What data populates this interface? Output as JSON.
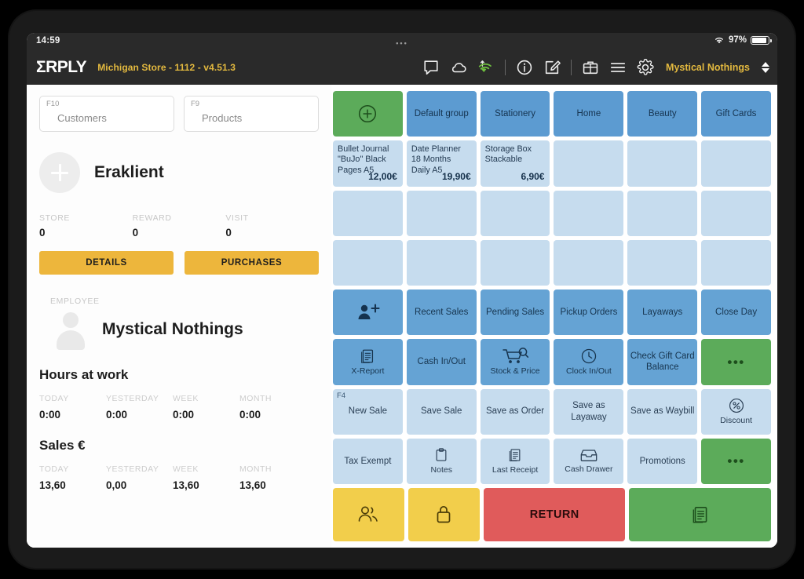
{
  "status_bar": {
    "time": "14:59",
    "dots": "•••",
    "battery_percent": "97%"
  },
  "app_bar": {
    "logo": "ΣRPLY",
    "store": "Michigan Store - 1112 - v4.51.3",
    "user": "Mystical Nothings",
    "icons": [
      "chat-icon",
      "cloud-icon",
      "wifi-sync-icon",
      "info-icon",
      "edit-icon",
      "briefcase-icon",
      "menu-icon",
      "gear-icon"
    ]
  },
  "left_panel": {
    "search": [
      {
        "fkey": "F10",
        "placeholder": "Customers"
      },
      {
        "fkey": "F9",
        "placeholder": "Products"
      }
    ],
    "customer": {
      "name": "Eraklient"
    },
    "customer_stats": [
      {
        "label": "STORE",
        "value": "0"
      },
      {
        "label": "REWARD",
        "value": "0"
      },
      {
        "label": "VISIT",
        "value": "0"
      }
    ],
    "buttons": [
      "DETAILS",
      "PURCHASES"
    ],
    "employee_label": "EMPLOYEE",
    "employee_name": "Mystical Nothings",
    "hours": {
      "title": "Hours at work",
      "columns": [
        "TODAY",
        "YESTERDAY",
        "WEEK",
        "MONTH"
      ],
      "values": [
        "0:00",
        "0:00",
        "0:00",
        "0:00"
      ]
    },
    "sales": {
      "title": "Sales €",
      "columns": [
        "TODAY",
        "YESTERDAY",
        "WEEK",
        "MONTH"
      ],
      "values": [
        "13,60",
        "0,00",
        "13,60",
        "13,60"
      ]
    }
  },
  "grid": {
    "groups_row": [
      {
        "type": "green",
        "icon": "plus-circle-icon",
        "label": ""
      },
      {
        "type": "blue",
        "label": "Default group"
      },
      {
        "type": "blue",
        "label": "Stationery"
      },
      {
        "type": "blue",
        "label": "Home"
      },
      {
        "type": "blue",
        "label": "Beauty"
      },
      {
        "type": "blue",
        "label": "Gift Cards"
      }
    ],
    "products_row": [
      {
        "name": "Bullet Journal \"BuJo\" Black Pages A5",
        "price": "12,00€"
      },
      {
        "name": "Date Planner 18 Months Daily A5",
        "price": "19,90€"
      },
      {
        "name": "Storage Box Stackable",
        "price": "6,90€"
      },
      {
        "name": "",
        "price": ""
      },
      {
        "name": "",
        "price": ""
      },
      {
        "name": "",
        "price": ""
      }
    ],
    "empty_rows": 2,
    "functions_row_1": [
      {
        "type": "func",
        "icon": "add-customer-icon",
        "label": ""
      },
      {
        "type": "func",
        "label": "Recent Sales"
      },
      {
        "type": "func",
        "label": "Pending Sales"
      },
      {
        "type": "func",
        "label": "Pickup Orders"
      },
      {
        "type": "func",
        "label": "Layaways"
      },
      {
        "type": "func",
        "label": "Close Day"
      }
    ],
    "functions_row_2": [
      {
        "type": "func",
        "icon": "report-icon",
        "label": "X-Report"
      },
      {
        "type": "func",
        "label": "Cash In/Out"
      },
      {
        "type": "func",
        "icon": "cart-search-icon",
        "label": "Stock & Price"
      },
      {
        "type": "func",
        "icon": "clock-icon",
        "label": "Clock In/Out"
      },
      {
        "type": "func",
        "label": "Check Gift Card Balance"
      },
      {
        "type": "green",
        "label": "•••"
      }
    ],
    "functions_row_3": [
      {
        "type": "light",
        "fkey": "F4",
        "label": "New Sale"
      },
      {
        "type": "light",
        "label": "Save Sale"
      },
      {
        "type": "light",
        "label": "Save as Order"
      },
      {
        "type": "light",
        "label": "Save as Layaway"
      },
      {
        "type": "light",
        "label": "Save as Waybill"
      },
      {
        "type": "light",
        "icon": "percent-icon",
        "label": "Discount"
      }
    ],
    "functions_row_4": [
      {
        "type": "light",
        "label": "Tax Exempt"
      },
      {
        "type": "light",
        "icon": "notes-icon",
        "label": "Notes"
      },
      {
        "type": "light",
        "icon": "receipt-icon",
        "label": "Last Receipt"
      },
      {
        "type": "light",
        "icon": "drawer-icon",
        "label": "Cash Drawer"
      },
      {
        "type": "light",
        "label": "Promotions"
      },
      {
        "type": "green",
        "label": "•••"
      }
    ],
    "bottom_row": [
      {
        "type": "yellow",
        "icon": "users-icon",
        "label": ""
      },
      {
        "type": "yellow",
        "icon": "lock-icon",
        "label": ""
      },
      {
        "type": "red",
        "label": "RETURN",
        "wide": true
      },
      {
        "type": "green",
        "icon": "receipt-icon",
        "label": "",
        "wide": true
      }
    ]
  },
  "colors": {
    "accent_yellow": "#edb63c",
    "group_blue": "#5c9bd1",
    "func_blue": "#65a3d4",
    "light_blue": "#c6dcee",
    "green": "#5cab5a",
    "red": "#e05b5b",
    "header_dark": "#2a2a2a"
  }
}
